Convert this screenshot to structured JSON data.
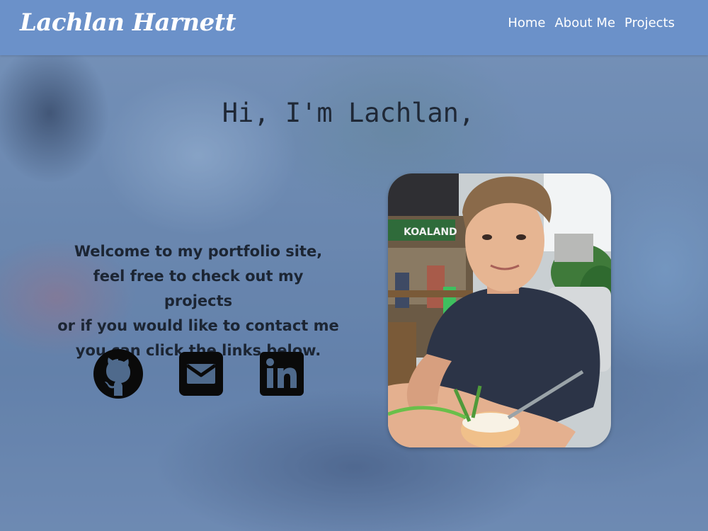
{
  "header": {
    "brand": "Lachlan Harnett",
    "nav": [
      {
        "label": "Home"
      },
      {
        "label": "About Me"
      },
      {
        "label": "Projects"
      }
    ]
  },
  "hero": {
    "greeting": "Hi, I'm Lachlan,",
    "welcome_lines": [
      "Welcome to my portfolio site,",
      "feel free to check out my projects",
      "or if you would like to contact me",
      "you can click the links below."
    ]
  },
  "social_links": [
    {
      "icon": "github-icon"
    },
    {
      "icon": "email-icon"
    },
    {
      "icon": "linkedin-icon"
    }
  ],
  "photo": {
    "sign_text": "KOALAND",
    "icon": "profile-photo"
  },
  "colors": {
    "navbar": "#6b91c9",
    "text_dark": "#1c2533",
    "icon_color": "#0a0a0a"
  }
}
